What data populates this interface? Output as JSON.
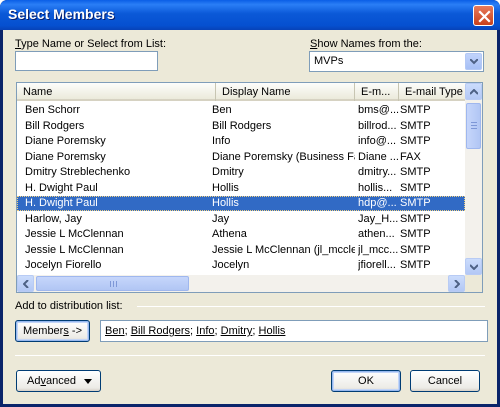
{
  "window": {
    "title": "Select Members"
  },
  "search": {
    "label_accel": "T",
    "label_rest": "ype Name or Select from List:",
    "value": ""
  },
  "show_names": {
    "label_accel": "S",
    "label_rest": "how Names from the:",
    "selected": "MVPs"
  },
  "list": {
    "columns": [
      "Name",
      "Display Name",
      "E-m...",
      "E-mail Type"
    ],
    "rows": [
      {
        "name": "Ben Schorr",
        "display": "Ben",
        "email": "bms@...",
        "type": "SMTP",
        "selected": false
      },
      {
        "name": "Bill Rodgers",
        "display": "Bill Rodgers",
        "email": "billrod...",
        "type": "SMTP",
        "selected": false
      },
      {
        "name": "Diane Poremsky",
        "display": "Info",
        "email": "info@...",
        "type": "SMTP",
        "selected": false
      },
      {
        "name": "Diane Poremsky",
        "display": "Diane Poremsky (Business Fax)",
        "email": "Diane ...",
        "type": "FAX",
        "selected": false
      },
      {
        "name": "Dmitry Streblechenko",
        "display": "Dmitry",
        "email": "dmitry...",
        "type": "SMTP",
        "selected": false
      },
      {
        "name": "H. Dwight Paul",
        "display": "Hollis",
        "email": "hollis...",
        "type": "SMTP",
        "selected": false
      },
      {
        "name": "H. Dwight Paul",
        "display": "Hollis",
        "email": "hdp@...",
        "type": "SMTP",
        "selected": true
      },
      {
        "name": "Harlow, Jay",
        "display": "Jay",
        "email": "Jay_H...",
        "type": "SMTP",
        "selected": false
      },
      {
        "name": "Jessie L McClennan",
        "display": "Athena",
        "email": "athen...",
        "type": "SMTP",
        "selected": false
      },
      {
        "name": "Jessie L McClennan",
        "display": "Jessie L McClennan (jl_mcclen...",
        "email": "jl_mcc...",
        "type": "SMTP",
        "selected": false
      },
      {
        "name": "Jocelyn Fiorello",
        "display": "Jocelyn",
        "email": "jfiorell...",
        "type": "SMTP",
        "selected": false
      }
    ]
  },
  "distribution": {
    "label": "Add to distribution list:",
    "button_accel": "s",
    "button_pre": "Member",
    "button_post": " ->",
    "members": [
      "Ben",
      "Bill Rodgers",
      "Info",
      "Dmitry",
      "Hollis"
    ]
  },
  "footer": {
    "advanced_accel": "v",
    "advanced_pre": "Ad",
    "advanced_post": "anced",
    "ok": "OK",
    "cancel": "Cancel"
  },
  "colors": {
    "selection": "#316ac5",
    "titlebar": "#0550d0",
    "dialog_bg": "#ece9d8"
  }
}
